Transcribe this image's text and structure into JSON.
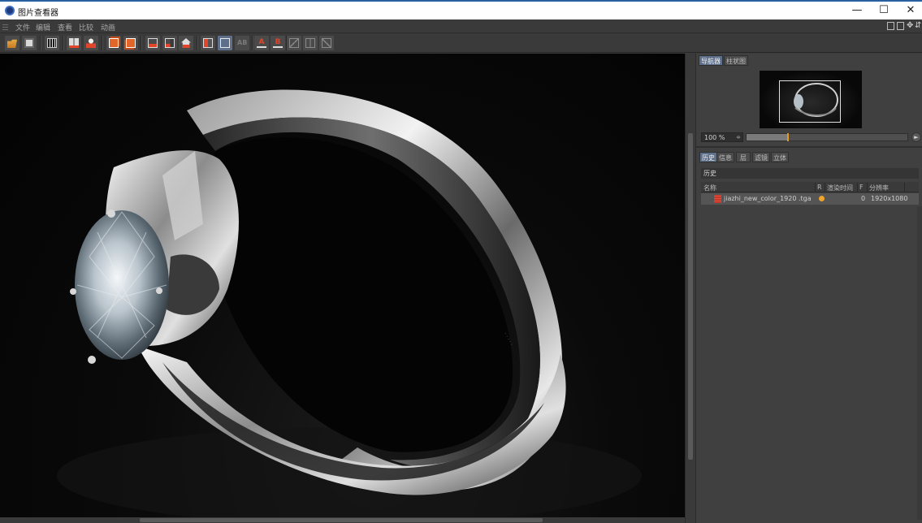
{
  "window": {
    "title": "图片查看器",
    "controls": {
      "minimize": "—",
      "maximize": "☐",
      "close": "✕"
    }
  },
  "menu": {
    "items": [
      "文件",
      "编辑",
      "查看",
      "比较",
      "动画"
    ]
  },
  "toolbar": {
    "buttons": [
      {
        "name": "open-icon"
      },
      {
        "name": "save-icon"
      },
      {
        "name": "filmstrip-icon"
      },
      {
        "name": "channels-icon"
      },
      {
        "name": "user-icon"
      },
      {
        "name": "copy-left-icon"
      },
      {
        "name": "copy-right-icon"
      },
      {
        "name": "region-a-icon"
      },
      {
        "name": "region-b-icon"
      },
      {
        "name": "home-icon"
      },
      {
        "name": "ab-split-icon"
      },
      {
        "name": "ab-toggle-icon"
      },
      {
        "name": "ab-off-icon"
      },
      {
        "name": "set-a-icon"
      },
      {
        "name": "set-b-icon"
      },
      {
        "name": "compare-1-icon"
      },
      {
        "name": "compare-2-icon"
      },
      {
        "name": "compare-3-icon"
      }
    ],
    "labels": {
      "ab": "AB",
      "a": "A",
      "b": "B"
    }
  },
  "navigator": {
    "tabs": [
      {
        "label": "导航器",
        "active": true
      },
      {
        "label": "柱状图",
        "active": false
      }
    ],
    "zoom": "100 %",
    "zoom_spin": "≑",
    "zoom_fraction": 0.25,
    "arrow": "►"
  },
  "history": {
    "tabs": [
      {
        "label": "历史",
        "active": true
      },
      {
        "label": "信息",
        "active": false
      },
      {
        "label": "层",
        "active": false
      },
      {
        "label": "滤镜",
        "active": false
      },
      {
        "label": "立体",
        "active": false
      }
    ],
    "section_title": "历史",
    "columns": {
      "name": "名称",
      "r": "R",
      "render_time": "渲染时间",
      "f": "F",
      "resolution": "分辨率"
    },
    "rows": [
      {
        "name": "jiazhi_new_color_1920 .tga",
        "status_color": "#f0a52a",
        "f": "0",
        "resolution": "1920x1080"
      }
    ]
  },
  "colors": {
    "accent": "#5d6f8a",
    "status": "#f0a52a",
    "zoom_knob": "#e59a1e"
  }
}
